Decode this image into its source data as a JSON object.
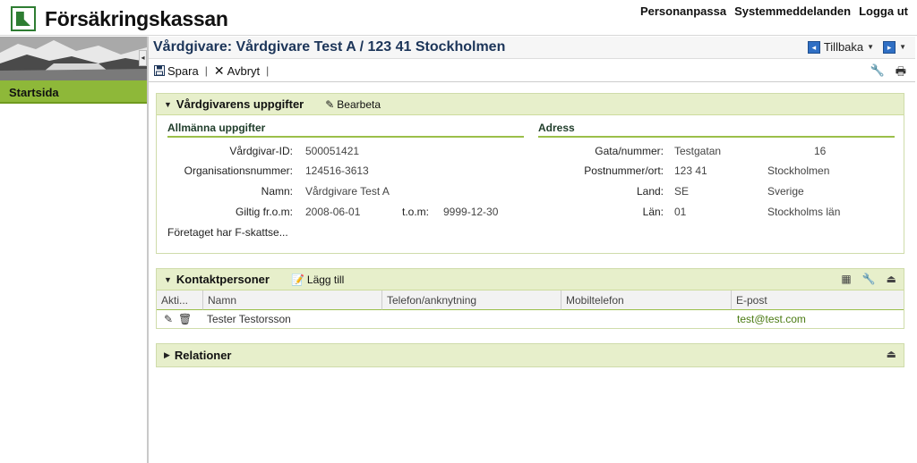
{
  "header": {
    "logo_text": "Försäkringskassan",
    "links": [
      "Personanpassa",
      "Systemmeddelanden",
      "Logga ut"
    ]
  },
  "nav": {
    "start_label": "Startsida"
  },
  "titlebar": {
    "title": "Vårdgivare: Vårdgivare Test A / 123 41 Stockholmen",
    "back_label": "Tillbaka"
  },
  "toolbar": {
    "save_label": "Spara",
    "cancel_label": "Avbryt"
  },
  "panel_provider": {
    "title": "Vårdgivarens uppgifter",
    "edit_label": "Bearbeta",
    "general": {
      "title": "Allmänna uppgifter",
      "id_label": "Vårdgivar-ID:",
      "id_value": "500051421",
      "org_label": "Organisationsnummer:",
      "org_value": "124516-3613",
      "name_label": "Namn:",
      "name_value": "Vårdgivare Test A",
      "from_label": "Giltig fr.o.m:",
      "from_value": "2008-06-01",
      "to_label": "t.o.m:",
      "to_value": "9999-12-30",
      "ftax": "Företaget har F-skattse..."
    },
    "address": {
      "title": "Adress",
      "street_label": "Gata/nummer:",
      "street_value": "Testgatan",
      "street_number": "16",
      "postal_label": "Postnummer/ort:",
      "postal_value": "123 41",
      "city_value": "Stockholmen",
      "country_label": "Land:",
      "country_code": "SE",
      "country_name": "Sverige",
      "county_label": "Län:",
      "county_code": "01",
      "county_name": "Stockholms län"
    }
  },
  "panel_contacts": {
    "title": "Kontaktpersoner",
    "add_label": "Lägg till",
    "columns": [
      "Akti...",
      "Namn",
      "Telefon/anknytning",
      "Mobiltelefon",
      "E-post"
    ],
    "rows": [
      {
        "name": "Tester Testorsson",
        "phone": "",
        "mobile": "",
        "email": "test@test.com"
      }
    ]
  },
  "panel_relations": {
    "title": "Relationer"
  },
  "colors": {
    "accent_green": "#8eb839",
    "panel_header": "#e7efcb",
    "title_blue": "#1c3559"
  }
}
